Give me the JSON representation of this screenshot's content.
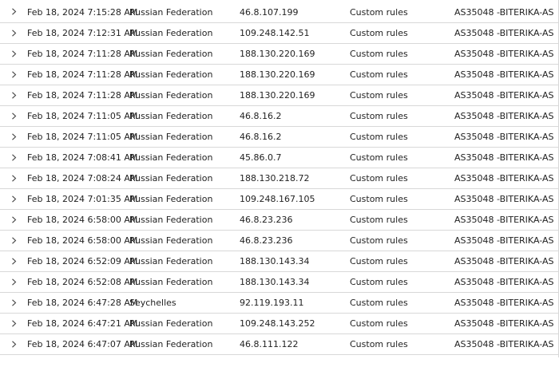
{
  "rows": [
    {
      "date": "Feb 18, 2024 7:15:28 AM",
      "country": "Russian Federation",
      "ip": "46.8.107.199",
      "rule": "Custom rules",
      "asn": "AS35048 -BITERIKA-AS"
    },
    {
      "date": "Feb 18, 2024 7:12:31 AM",
      "country": "Russian Federation",
      "ip": "109.248.142.51",
      "rule": "Custom rules",
      "asn": "AS35048 -BITERIKA-AS"
    },
    {
      "date": "Feb 18, 2024 7:11:28 AM",
      "country": "Russian Federation",
      "ip": "188.130.220.169",
      "rule": "Custom rules",
      "asn": "AS35048 -BITERIKA-AS"
    },
    {
      "date": "Feb 18, 2024 7:11:28 AM",
      "country": "Russian Federation",
      "ip": "188.130.220.169",
      "rule": "Custom rules",
      "asn": "AS35048 -BITERIKA-AS"
    },
    {
      "date": "Feb 18, 2024 7:11:28 AM",
      "country": "Russian Federation",
      "ip": "188.130.220.169",
      "rule": "Custom rules",
      "asn": "AS35048 -BITERIKA-AS"
    },
    {
      "date": "Feb 18, 2024 7:11:05 AM",
      "country": "Russian Federation",
      "ip": "46.8.16.2",
      "rule": "Custom rules",
      "asn": "AS35048 -BITERIKA-AS"
    },
    {
      "date": "Feb 18, 2024 7:11:05 AM",
      "country": "Russian Federation",
      "ip": "46.8.16.2",
      "rule": "Custom rules",
      "asn": "AS35048 -BITERIKA-AS"
    },
    {
      "date": "Feb 18, 2024 7:08:41 AM",
      "country": "Russian Federation",
      "ip": "45.86.0.7",
      "rule": "Custom rules",
      "asn": "AS35048 -BITERIKA-AS"
    },
    {
      "date": "Feb 18, 2024 7:08:24 AM",
      "country": "Russian Federation",
      "ip": "188.130.218.72",
      "rule": "Custom rules",
      "asn": "AS35048 -BITERIKA-AS"
    },
    {
      "date": "Feb 18, 2024 7:01:35 AM",
      "country": "Russian Federation",
      "ip": "109.248.167.105",
      "rule": "Custom rules",
      "asn": "AS35048 -BITERIKA-AS"
    },
    {
      "date": "Feb 18, 2024 6:58:00 AM",
      "country": "Russian Federation",
      "ip": "46.8.23.236",
      "rule": "Custom rules",
      "asn": "AS35048 -BITERIKA-AS"
    },
    {
      "date": "Feb 18, 2024 6:58:00 AM",
      "country": "Russian Federation",
      "ip": "46.8.23.236",
      "rule": "Custom rules",
      "asn": "AS35048 -BITERIKA-AS"
    },
    {
      "date": "Feb 18, 2024 6:52:09 AM",
      "country": "Russian Federation",
      "ip": "188.130.143.34",
      "rule": "Custom rules",
      "asn": "AS35048 -BITERIKA-AS"
    },
    {
      "date": "Feb 18, 2024 6:52:08 AM",
      "country": "Russian Federation",
      "ip": "188.130.143.34",
      "rule": "Custom rules",
      "asn": "AS35048 -BITERIKA-AS"
    },
    {
      "date": "Feb 18, 2024 6:47:28 AM",
      "country": "Seychelles",
      "ip": "92.119.193.11",
      "rule": "Custom rules",
      "asn": "AS35048 -BITERIKA-AS"
    },
    {
      "date": "Feb 18, 2024 6:47:21 AM",
      "country": "Russian Federation",
      "ip": "109.248.143.252",
      "rule": "Custom rules",
      "asn": "AS35048 -BITERIKA-AS"
    },
    {
      "date": "Feb 18, 2024 6:47:07 AM",
      "country": "Russian Federation",
      "ip": "46.8.111.122",
      "rule": "Custom rules",
      "asn": "AS35048 -BITERIKA-AS"
    }
  ],
  "icons": {
    "expand": "chevron-right-icon"
  }
}
